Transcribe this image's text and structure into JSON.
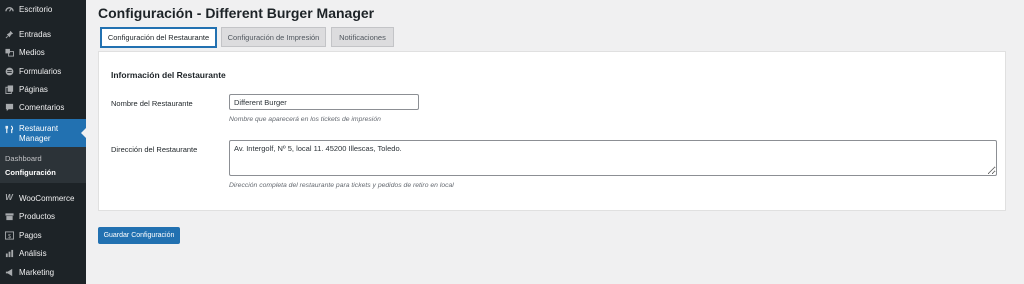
{
  "sidebar": {
    "items": [
      {
        "label": "Escritorio",
        "icon": "dashboard-icon"
      },
      {
        "label": "Entradas",
        "icon": "pin-icon"
      },
      {
        "label": "Medios",
        "icon": "media-icon"
      },
      {
        "label": "Formularios",
        "icon": "forms-icon"
      },
      {
        "label": "Páginas",
        "icon": "pages-icon"
      },
      {
        "label": "Comentarios",
        "icon": "comments-icon"
      },
      {
        "label": "Restaurant Manager",
        "icon": "utensils-icon"
      },
      {
        "label": "WooCommerce",
        "icon": "woocommerce-icon"
      },
      {
        "label": "Productos",
        "icon": "products-icon"
      },
      {
        "label": "Pagos",
        "icon": "payments-icon"
      },
      {
        "label": "Análisis",
        "icon": "analytics-icon"
      },
      {
        "label": "Marketing",
        "icon": "megaphone-icon"
      }
    ],
    "submenu": [
      {
        "label": "Dashboard"
      },
      {
        "label": "Configuración"
      }
    ]
  },
  "page": {
    "title": "Configuración - Different Burger Manager"
  },
  "tabs": [
    {
      "label": "Configuración del Restaurante"
    },
    {
      "label": "Configuración de Impresión"
    },
    {
      "label": "Notificaciones"
    }
  ],
  "form": {
    "section_title": "Información del Restaurante",
    "name_label": "Nombre del Restaurante",
    "name_value": "Different Burger",
    "name_desc": "Nombre que aparecerá en los tickets de impresión",
    "address_label": "Dirección del Restaurante",
    "address_value": "Av. Intergolf, Nº 5, local 11. 45200 Illescas, Toledo.",
    "address_desc": "Dirección completa del restaurante para tickets y pedidos de retiro en local"
  },
  "actions": {
    "save_label": "Guardar Configuración"
  },
  "colors": {
    "sidebar_bg": "#1d2327",
    "accent": "#2271b1",
    "page_bg": "#f0f0f1"
  }
}
